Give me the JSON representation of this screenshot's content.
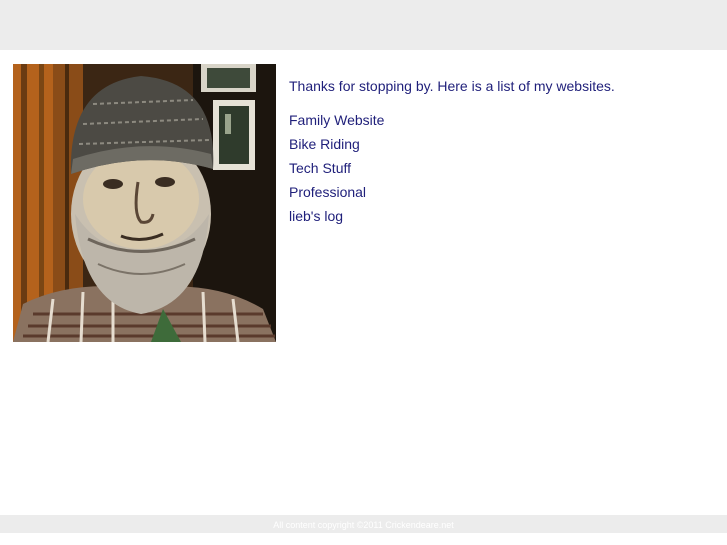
{
  "intro": "Thanks for stopping by. Here is a list of my websites.",
  "links": [
    {
      "label": "Family Website"
    },
    {
      "label": "Bike Riding"
    },
    {
      "label": "Tech Stuff"
    },
    {
      "label": "Professional"
    },
    {
      "label": "lieb's log"
    }
  ],
  "footer": "All content copyright ©2011 Crickendeare.net",
  "colors": {
    "link": "#1f1f7a",
    "bar": "#ececec"
  }
}
